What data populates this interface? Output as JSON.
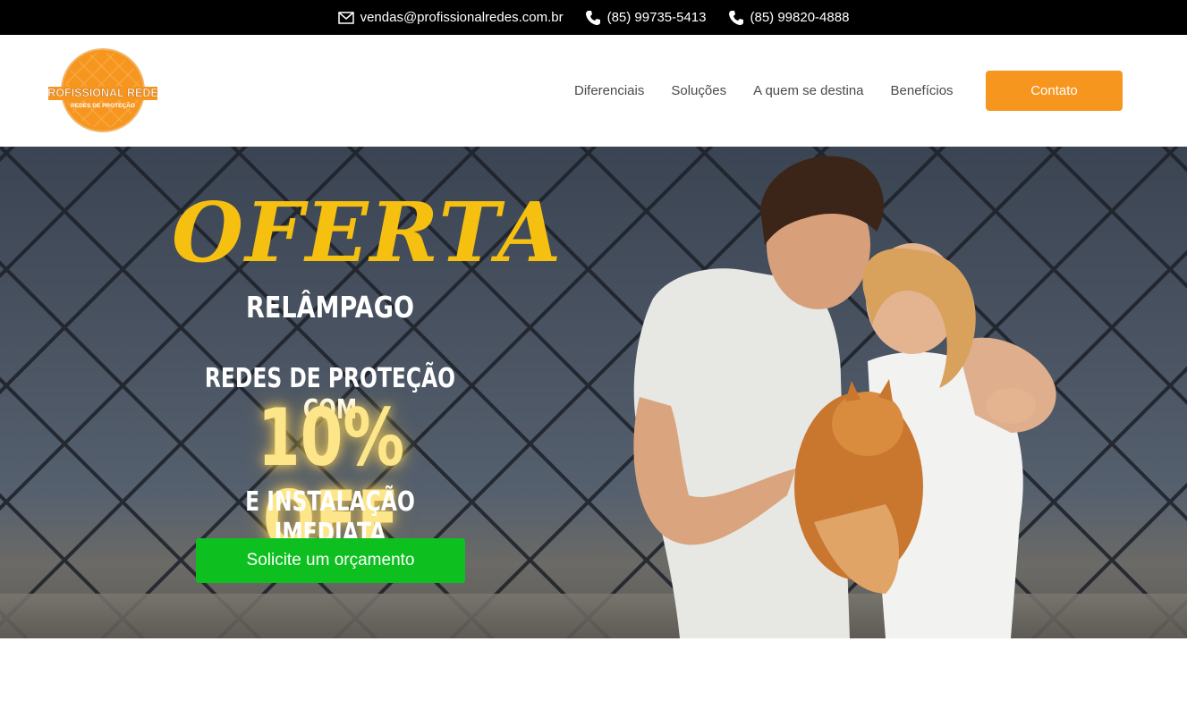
{
  "topbar": {
    "email": "vendas@profissionalredes.com.br",
    "phone1": "(85) 99735-5413",
    "phone2": "(85) 99820-4888"
  },
  "logo": {
    "line1": "PROFISSIONAL REDES",
    "line2": "REDES DE PROTEÇÃO"
  },
  "nav": {
    "items": [
      "Diferenciais",
      "Soluções",
      "A quem se destina",
      "Benefícios"
    ],
    "contact_label": "Contato"
  },
  "hero": {
    "headline": "OFERTA",
    "subheadline": "RELÂMPAGO",
    "offer_line1": "REDES DE PROTEÇÃO COM",
    "offer_discount": "10% OFF",
    "offer_line2": "E INSTALAÇÃO IMEDIATA",
    "cta_label": "Solicite um orçamento"
  },
  "colors": {
    "topbar_bg": "#000000",
    "brand_orange": "#f7961e",
    "headline_yellow": "#f6c010",
    "cta_green": "#0dc01f"
  },
  "icons": [
    "mail-icon",
    "phone-icon",
    "phone-icon"
  ]
}
